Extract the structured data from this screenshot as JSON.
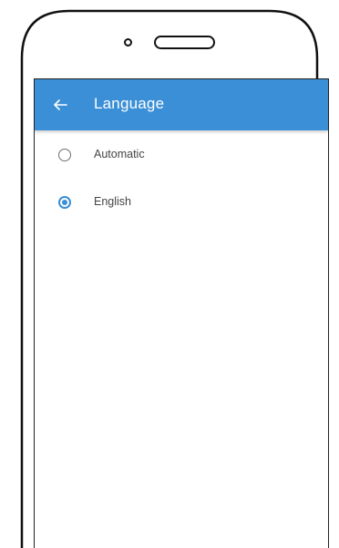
{
  "colors": {
    "accent": "#3a8fd6",
    "app_bar_text": "#ffffff",
    "label_text": "#444444",
    "outline": "#111111"
  },
  "app_bar": {
    "title": "Language",
    "back_icon": "arrow-left-icon"
  },
  "options": [
    {
      "label": "Automatic",
      "selected": false
    },
    {
      "label": "English",
      "selected": true
    }
  ]
}
